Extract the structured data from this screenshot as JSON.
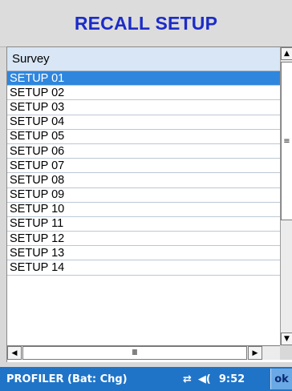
{
  "window": {
    "title": "RECALL SETUP"
  },
  "list": {
    "column_header": "Survey",
    "items": [
      "SETUP 01",
      "SETUP 02",
      "SETUP 03",
      "SETUP 04",
      "SETUP 05",
      "SETUP 06",
      "SETUP 07",
      "SETUP 08",
      "SETUP 09",
      "SETUP 10",
      "SETUP 11",
      "SETUP 12",
      "SETUP 13",
      "SETUP 14"
    ],
    "selected_item": "SETUP 01"
  },
  "taskbar": {
    "app_label": "PROFILER (Bat: Chg)",
    "time": "9:52",
    "ok_label": "ok"
  },
  "colors": {
    "title_text": "#1c2cc8",
    "selection": "#2f86dd",
    "taskbar": "#1f74c8",
    "header_bg": "#d8e6f5"
  },
  "icons": [
    "connectivity-icon",
    "speaker-icon",
    "scroll-up-icon",
    "scroll-down-icon",
    "scroll-left-icon",
    "scroll-right-icon"
  ]
}
